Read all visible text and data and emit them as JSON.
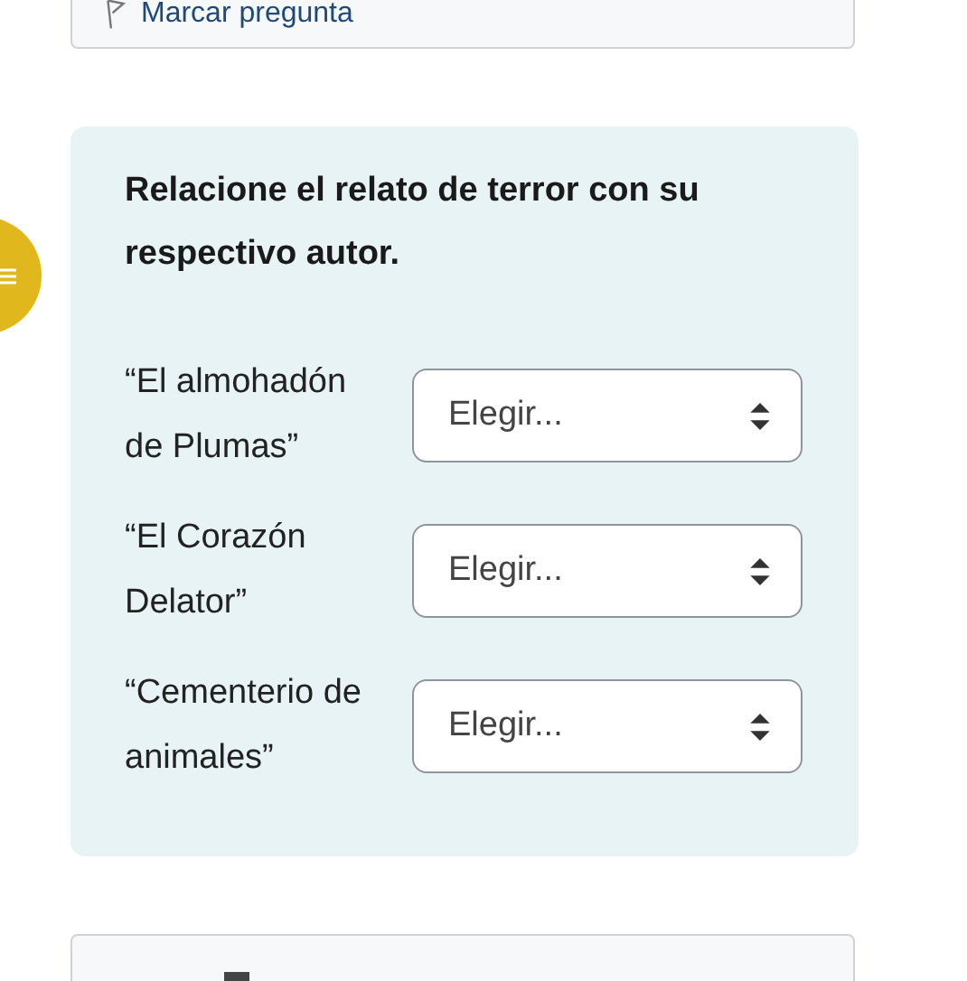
{
  "flag_card": {
    "link": "Marcar pregunta"
  },
  "question": {
    "prompt": "Relacione el relato de terror con su respectivo autor.",
    "items": [
      {
        "label": "“El almohadón de Plumas”",
        "choice": "Elegir..."
      },
      {
        "label": "“El Corazón Delator”",
        "choice": "Elegir..."
      },
      {
        "label": "“Cementerio de animales”",
        "choice": "Elegir..."
      }
    ]
  }
}
